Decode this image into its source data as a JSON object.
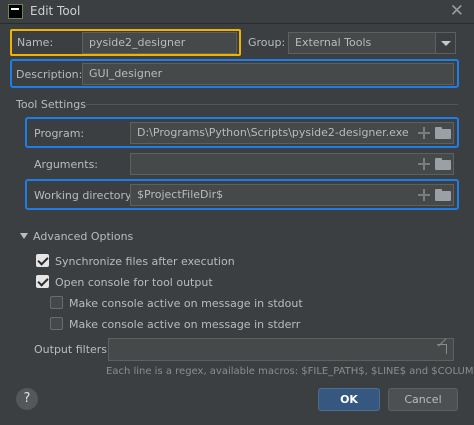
{
  "window": {
    "title": "Edit Tool",
    "close": "✕"
  },
  "name": {
    "label": "Name:",
    "value": "pyside2_designer"
  },
  "group": {
    "label": "Group:",
    "value": "External Tools"
  },
  "description": {
    "label": "Description:",
    "value": "GUI_designer"
  },
  "tool_settings": {
    "header": "Tool Settings",
    "program": {
      "label": "Program:",
      "value": "D:\\Programs\\Python\\Scripts\\pyside2-designer.exe"
    },
    "arguments": {
      "label": "Arguments:",
      "value": ""
    },
    "working_dir": {
      "label": "Working directory:",
      "value": "$ProjectFileDir$"
    }
  },
  "advanced": {
    "header": "Advanced Options",
    "options": [
      {
        "label": "Synchronize files after execution",
        "checked": true
      },
      {
        "label": "Open console for tool output",
        "checked": true
      },
      {
        "label": "Make console active on message in stdout",
        "checked": false
      },
      {
        "label": "Make console active on message in stderr",
        "checked": false
      }
    ],
    "output_filters": {
      "label": "Output filters:",
      "value": ""
    },
    "hint": "Each line is a regex, available macros: $FILE_PATH$, $LINE$ and $COLUMN$"
  },
  "buttons": {
    "help": "?",
    "ok": "OK",
    "cancel": "Cancel"
  },
  "colors": {
    "highlight_yellow": "#f0b400",
    "highlight_blue": "#1e7ee6",
    "ok_button": "#365880"
  }
}
